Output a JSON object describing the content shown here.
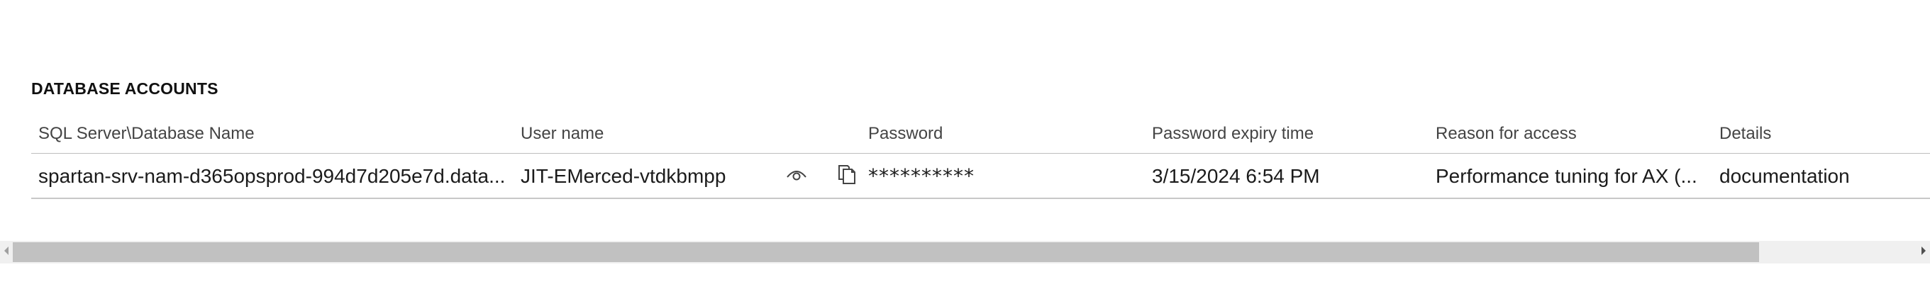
{
  "section": {
    "title": "DATABASE ACCOUNTS"
  },
  "table": {
    "columns": [
      "SQL Server\\Database Name",
      "User name",
      "Password",
      "Password expiry time",
      "Reason for access",
      "Details"
    ],
    "rows": [
      {
        "server_database": "spartan-srv-nam-d365opsprod-994d7d205e7d.data...",
        "user_name": "JIT-EMerced-vtdkbmpp",
        "password": "**********",
        "expiry": "3/15/2024 6:54 PM",
        "reason": "Performance tuning for AX (...",
        "details": "documentation"
      }
    ]
  },
  "icons": {
    "show_password": "eye-icon",
    "copy": "copy-icon",
    "scroll_left": "arrow-left-icon",
    "scroll_right": "arrow-right-icon"
  },
  "colors": {
    "header_text": "#444444",
    "row_border": "#c8c8c8",
    "scroll_thumb": "#c1c1c1",
    "scroll_track": "#f0f0f0"
  }
}
